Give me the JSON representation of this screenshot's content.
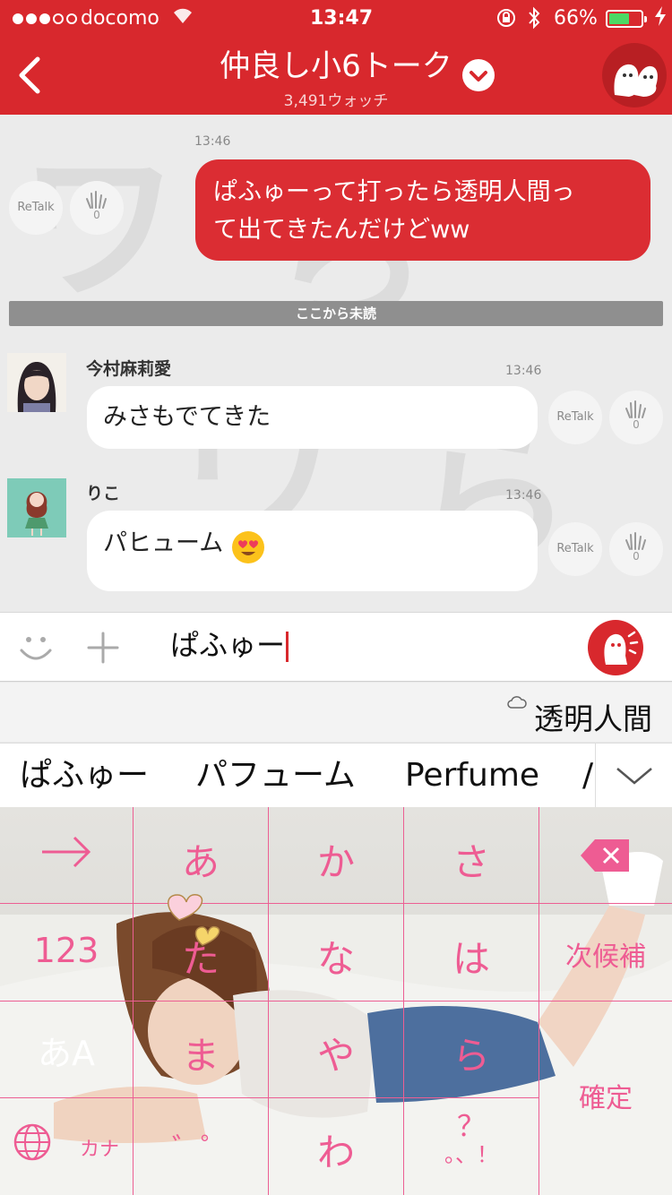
{
  "status": {
    "carrier": "docomo",
    "time": "13:47",
    "battery": "66%",
    "battery_level": 0.66
  },
  "header": {
    "title": "仲良し小6トーク",
    "subtitle": "3,491ウォッチ"
  },
  "messages": {
    "out": {
      "time": "13:46",
      "text_line1": "ぱふゅーって打ったら透明人間っ",
      "text_line2": "て出てきたんだけどww",
      "retalk": "ReTalk",
      "clap_count": "0"
    },
    "divider": "ここから未読",
    "in": [
      {
        "name": "今村麻莉愛",
        "time": "13:46",
        "text": "みさもでてきた",
        "retalk": "ReTalk",
        "clap_count": "0"
      },
      {
        "name": "りこ",
        "time": "13:46",
        "text": "パヒューム",
        "retalk": "ReTalk",
        "clap_count": "0"
      }
    ]
  },
  "input": {
    "value": "ぱふゅー"
  },
  "prediction": {
    "cloud_candidate": "透明人間",
    "candidates": [
      "ぱふゅー",
      "パフューム",
      "Perfume",
      "/"
    ]
  },
  "keyboard": {
    "keys": {
      "k_abc": "123",
      "k_a": "あ",
      "k_ka": "か",
      "k_sa": "さ",
      "k_ta": "た",
      "k_na": "な",
      "k_ha": "は",
      "k_next": "次候補",
      "k_mode": "あA",
      "k_ma": "ま",
      "k_ya": "や",
      "k_ra": "ら",
      "k_confirm": "確定",
      "k_kana": "カナ",
      "k_dakuten": "゛゜",
      "k_wa": "わ",
      "k_punct_top": "？",
      "k_punct_bottom": "。、！"
    }
  },
  "colors": {
    "brand": "#d8282d",
    "key_pink": "#ee5c93"
  }
}
